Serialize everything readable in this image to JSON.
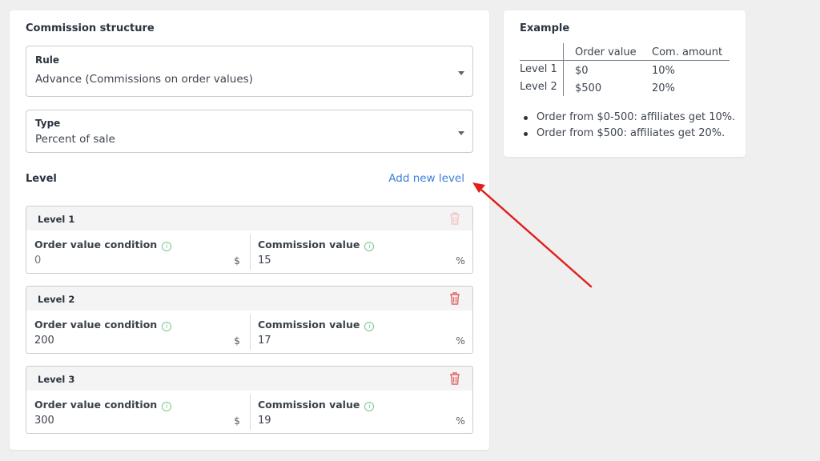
{
  "commission": {
    "title": "Commission structure",
    "rule_label": "Rule",
    "rule_value": "Advance (Commissions on order values)",
    "type_label": "Type",
    "type_value": "Percent of sale",
    "level_section_label": "Level",
    "add_level_label": "Add new level",
    "levels": [
      {
        "title": "Level 1",
        "order_label": "Order value condition",
        "order_value": "",
        "order_placeholder": "0",
        "order_unit": "$",
        "commission_label": "Commission value",
        "commission_value": "15",
        "commission_unit": "%",
        "delete_disabled": true
      },
      {
        "title": "Level 2",
        "order_label": "Order value condition",
        "order_value": "200",
        "order_unit": "$",
        "commission_label": "Commission value",
        "commission_value": "17",
        "commission_unit": "%",
        "delete_disabled": false
      },
      {
        "title": "Level 3",
        "order_label": "Order value condition",
        "order_value": "300",
        "order_unit": "$",
        "commission_label": "Commission value",
        "commission_value": "19",
        "commission_unit": "%",
        "delete_disabled": false
      }
    ]
  },
  "example": {
    "title": "Example",
    "headers": [
      "Order value",
      "Com. amount"
    ],
    "rows": [
      {
        "label": "Level 1",
        "order": "$0",
        "amount": "10%"
      },
      {
        "label": "Level 2",
        "order": "$500",
        "amount": "20%"
      }
    ],
    "bullets": [
      "Order from $0-500: affiliates get 10%.",
      "Order from $500: affiliates get 20%."
    ]
  },
  "colors": {
    "link": "#3d7fd6",
    "delete_icon": "#e06666",
    "delete_icon_disabled": "#f3c7c7",
    "info_icon": "#7fc58a",
    "annotation_arrow": "#e0201c"
  },
  "icons": {
    "dropdown": "caret-down-icon",
    "delete": "trash-icon",
    "info": "info-circle-icon",
    "annotation": "arrow-icon"
  }
}
